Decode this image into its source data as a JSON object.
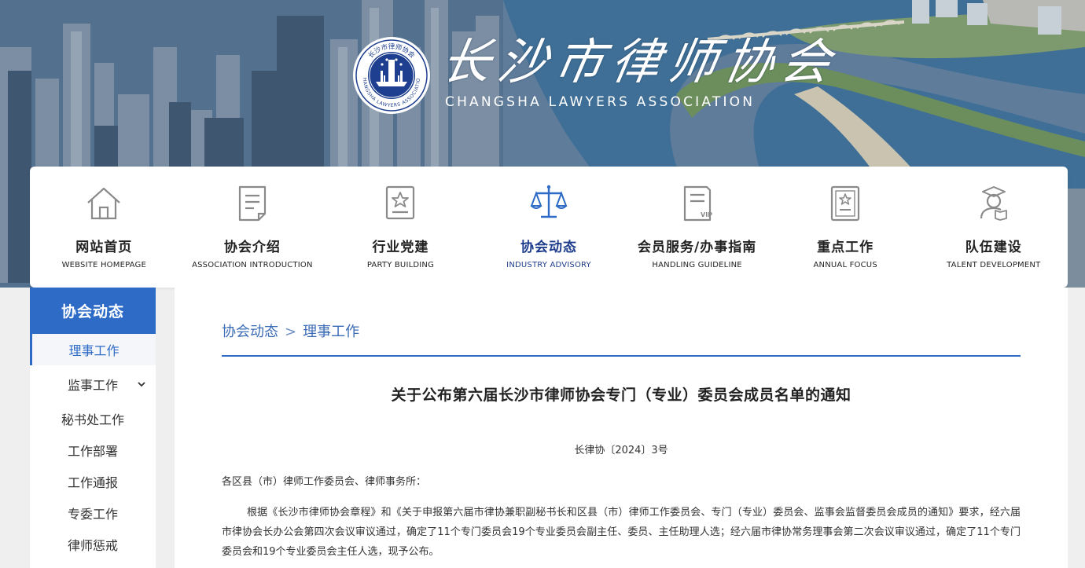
{
  "header": {
    "title": "长沙市律师协会",
    "subtitle": "CHANGSHA LAWYERS ASSOCIATION",
    "logo_text": "长沙市律师协会 · CHANGSHA LAWYERS ASSOCIATION"
  },
  "nav": {
    "items": [
      {
        "zh": "网站首页",
        "en": "WEBSITE HOMEPAGE",
        "icon": "house-icon"
      },
      {
        "zh": "协会介绍",
        "en": "ASSOCIATION INTRODUCTION",
        "icon": "document-icon"
      },
      {
        "zh": "行业党建",
        "en": "PARTY BUILDING",
        "icon": "badge-icon"
      },
      {
        "zh": "协会动态",
        "en": "INDUSTRY ADVISORY",
        "icon": "scales-icon"
      },
      {
        "zh": "会员服务/办事指南",
        "en": "HANDLING GUIDELINE",
        "icon": "vip-card-icon"
      },
      {
        "zh": "重点工作",
        "en": "ANNUAL FOCUS",
        "icon": "certificate-icon"
      },
      {
        "zh": "队伍建设",
        "en": "TALENT DEVELOPMENT",
        "icon": "graduate-icon"
      }
    ],
    "active_index": 3
  },
  "sidebar": {
    "title": "协会动态",
    "items": [
      {
        "label": "理事工作"
      },
      {
        "label": "监事工作"
      },
      {
        "label": "秘书处工作"
      },
      {
        "label": "工作部署"
      },
      {
        "label": "工作通报"
      },
      {
        "label": "专委工作"
      },
      {
        "label": "律师惩戒"
      }
    ]
  },
  "breadcrumb": {
    "items": [
      "协会动态",
      "理事工作"
    ],
    "separator": ">"
  },
  "article": {
    "title": "关于公布第六届长沙市律师协会专门（专业）委员会成员名单的通知",
    "doc_number": "长律协〔2024〕3号",
    "salutation": "各区县（市）律师工作委员会、律师事务所：",
    "body": "根据《长沙市律师协会章程》和《关于申报第六届市律协兼职副秘书长和区县（市）律师工作委员会、专门（专业）委员会、监事会监督委员会成员的通知》要求，经六届市律协会长办公会第四次会议审议通过，确定了11个专门委员会19个专业委员会副主任、委员、主任助理人选；经六届市律协常务理事会第二次会议审议通过，确定了11个专门委员会和19个专业委员会主任人选，现予公布。"
  },
  "colors": {
    "accent": "#2e6bc6",
    "nav_active": "#1d3d8c",
    "icon_gray": "#8a8a8a"
  }
}
